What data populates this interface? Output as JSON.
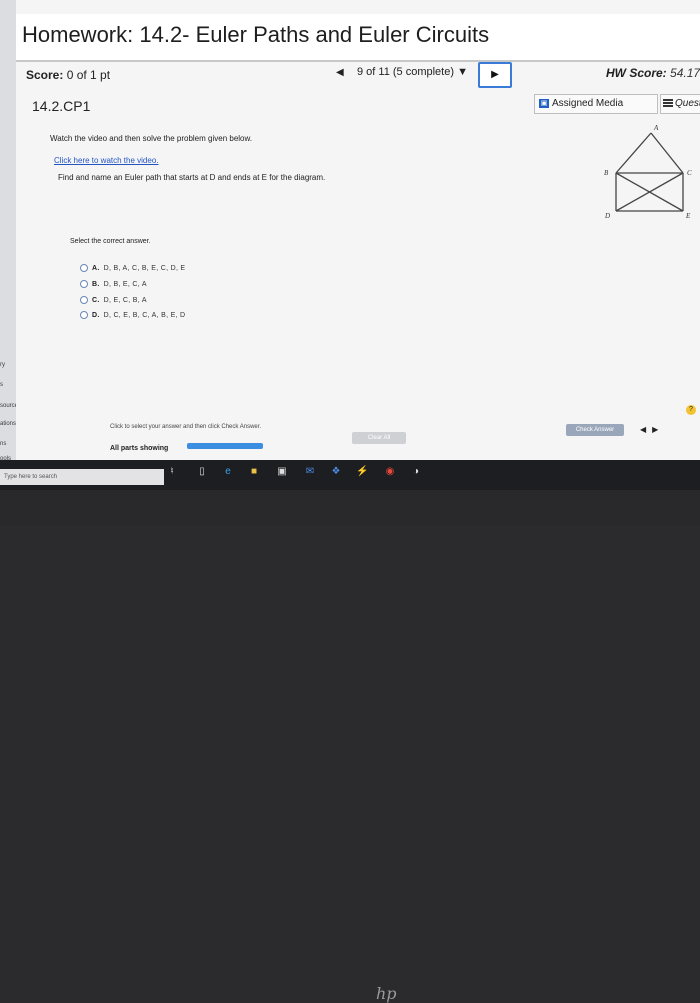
{
  "header": {
    "title": "Homework: 14.2- Euler Paths and Euler Circuits"
  },
  "score_row": {
    "score_label": "Score:",
    "score_value": "0 of 1 pt",
    "progress": "9 of 11 (5 complete)",
    "hw_score_label": "HW Score:",
    "hw_score_value": "54.17"
  },
  "question_bar": {
    "question_id": "14.2.CP1",
    "assigned_media": "Assigned Media",
    "question_help": "Questi"
  },
  "problem": {
    "instruction": "Watch the video and then solve the problem given below.",
    "video_link": "Click here to watch the video.",
    "prompt": "Find and name an Euler path that starts at D and ends at E for the diagram."
  },
  "diagram": {
    "vertex_labels": [
      "A",
      "B",
      "C",
      "D",
      "E"
    ]
  },
  "answers": {
    "prompt": "Select the correct answer.",
    "choices": [
      {
        "letter": "A.",
        "text": "D, B, A, C, B, E, C, D, E"
      },
      {
        "letter": "B.",
        "text": "D, B, E, C, A"
      },
      {
        "letter": "C.",
        "text": "D, E, C, B, A"
      },
      {
        "letter": "D.",
        "text": "D, C, E, B, C, A, B, E, D"
      }
    ]
  },
  "footer": {
    "note": "Click to select your answer and then click Check Answer.",
    "all_parts": "All parts showing",
    "clear_all": "Clear All",
    "check_answer": "Check Answer"
  },
  "sidebar": {
    "items": [
      "ry",
      "s",
      "sources",
      "ations",
      "ns",
      "ools"
    ]
  },
  "taskbar": {
    "search_placeholder": "Type here to search"
  },
  "bezel": {
    "logo": "hp"
  }
}
